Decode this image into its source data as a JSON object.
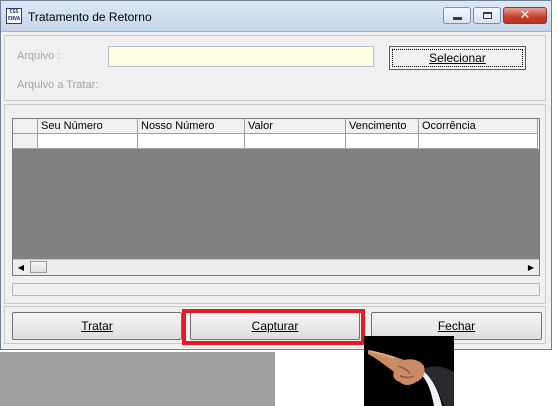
{
  "window": {
    "title": "Tratamento de Retorno",
    "app_icon_text": "CGS ENVA",
    "controls": [
      "minimize",
      "maximize",
      "close"
    ]
  },
  "form": {
    "arquivo_label": "Arquivo :",
    "arquivo_value": "",
    "arquivo_tratar_label": "Arquivo a Tratar:",
    "selecionar_button": "Selecionar"
  },
  "grid": {
    "columns": [
      "Seu Número",
      "Nosso Número",
      "Valor",
      "Vencimento",
      "Ocorrência"
    ],
    "rows": [
      [
        "",
        "",
        "",
        "",
        ""
      ]
    ]
  },
  "buttons": {
    "tratar": "Tratar",
    "capturar": "Capturar",
    "fechar": "Fechar"
  },
  "colors": {
    "highlight": "#e41b23",
    "input_background": "#ffffe1",
    "grid_background": "#808080"
  }
}
